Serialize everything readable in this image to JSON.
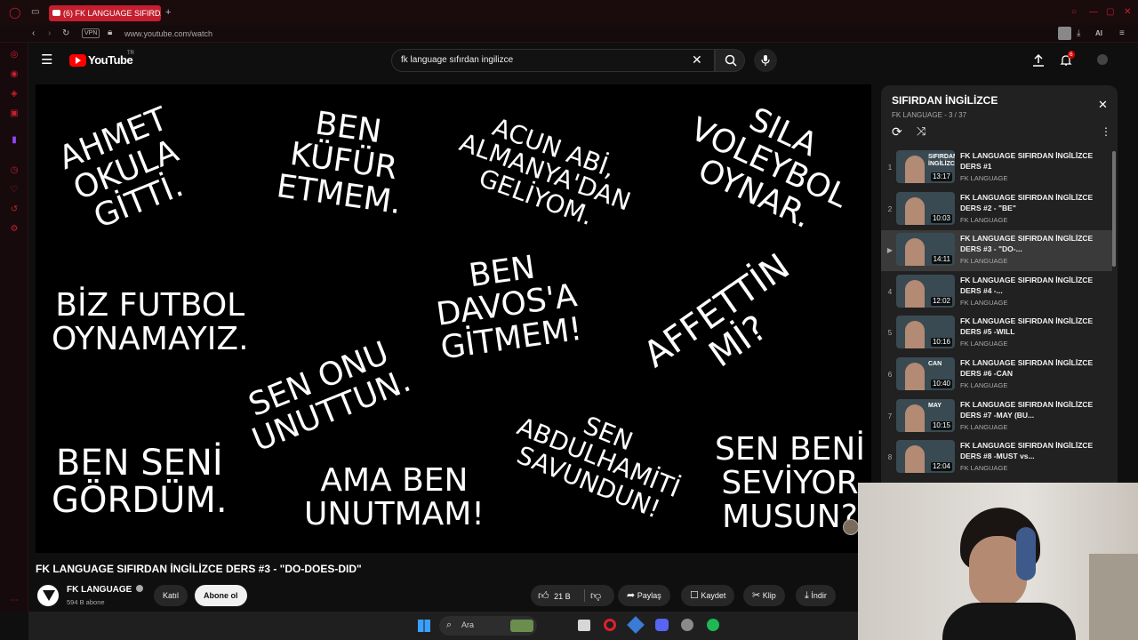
{
  "browser": {
    "tab_title": "(6) FK LANGUAGE SIFIRDA",
    "new_tab_symbol": "+",
    "vpn_label": "VPN",
    "url": "www.youtube.com/watch",
    "ai_label": "AI"
  },
  "header": {
    "logo_text": "YouTube",
    "region": "TR",
    "search_value": "fk language sıfırdan ingilizce",
    "notification_count": "6"
  },
  "video": {
    "phrases": {
      "p1": "AHMET\nOKULA\nGİTTİ.",
      "p2": "BEN\nKÜFÜR\nETMEM.",
      "p3": "ACUN ABİ,\nALMANYA'DAN\nGELİYOM.",
      "p4": "SILA\nVOLEYBOL\nOYNAR.",
      "p5": "BİZ FUTBOL\nOYNAMAYIZ.",
      "p6": "BEN\nDAVOS'A\nGİTMEM!",
      "p7": "AFFETTİN\nMİ?",
      "p8": "SEN ONU\nUNUTTUN.",
      "p9": "BEN SENİ\nGÖRDÜM.",
      "p10": "AMA BEN\nUNUTMAM!",
      "p11": "SEN\nABDULHAMİTİ\nSAVUNDUN!",
      "p12": "SEN BENİ\nSEVİYOR\nMUSUN?"
    },
    "title": "FK LANGUAGE SIFIRDAN İNGİLİZCE DERS #3 - \"DO-DOES-DID\""
  },
  "channel": {
    "name": "FK LANGUAGE",
    "subscribers": "594 B abone",
    "join_label": "Katıl",
    "subscribe_label": "Abone ol"
  },
  "actions": {
    "likes": "21 B",
    "share": "Paylaş",
    "save": "Kaydet",
    "clip": "Klip",
    "download": "İndir"
  },
  "playlist": {
    "title": "SIFIRDAN İNGİLİZCE",
    "subtitle": "FK LANGUAGE - 3 / 37",
    "items": [
      {
        "num": "1",
        "title": "FK LANGUAGE SIFIRDAN İNGİLİZCE DERS #1",
        "channel": "FK LANGUAGE",
        "duration": "13:17",
        "thumb_text": "SIFIRDAN İNGİLİZCE"
      },
      {
        "num": "2",
        "title": "FK LANGUAGE SIFIRDAN İNGİLİZCE DERS #2 - \"BE\"",
        "channel": "FK LANGUAGE",
        "duration": "10:03",
        "thumb_text": ""
      },
      {
        "num": "▶",
        "title": "FK LANGUAGE SIFIRDAN İNGİLİZCE DERS #3 - \"DO-...",
        "channel": "FK LANGUAGE",
        "duration": "14:11",
        "thumb_text": ""
      },
      {
        "num": "4",
        "title": "FK LANGUAGE SIFIRDAN İNGİLİZCE DERS #4 -...",
        "channel": "FK LANGUAGE",
        "duration": "12:02",
        "thumb_text": ""
      },
      {
        "num": "5",
        "title": "FK LANGUAGE SIFIRDAN İNGİLİZCE DERS #5 -WILL",
        "channel": "FK LANGUAGE",
        "duration": "10:16",
        "thumb_text": ""
      },
      {
        "num": "6",
        "title": "FK LANGUAGE SIFIRDAN İNGİLİZCE DERS #6 -CAN",
        "channel": "FK LANGUAGE",
        "duration": "10:40",
        "thumb_text": "CAN"
      },
      {
        "num": "7",
        "title": "FK LANGUAGE SIFIRDAN İNGİLİZCE DERS #7 -MAY (BU...",
        "channel": "FK LANGUAGE",
        "duration": "10:15",
        "thumb_text": "MAY"
      },
      {
        "num": "8",
        "title": "FK LANGUAGE SIFIRDAN İNGİLİZCE DERS #8 -MUST vs...",
        "channel": "FK LANGUAGE",
        "duration": "12:04",
        "thumb_text": ""
      }
    ]
  },
  "taskbar": {
    "search_label": "Ara"
  },
  "colors": {
    "accent_red": "#c51f2f",
    "youtube_red": "#ff0000",
    "background": "#0f0f0f"
  }
}
